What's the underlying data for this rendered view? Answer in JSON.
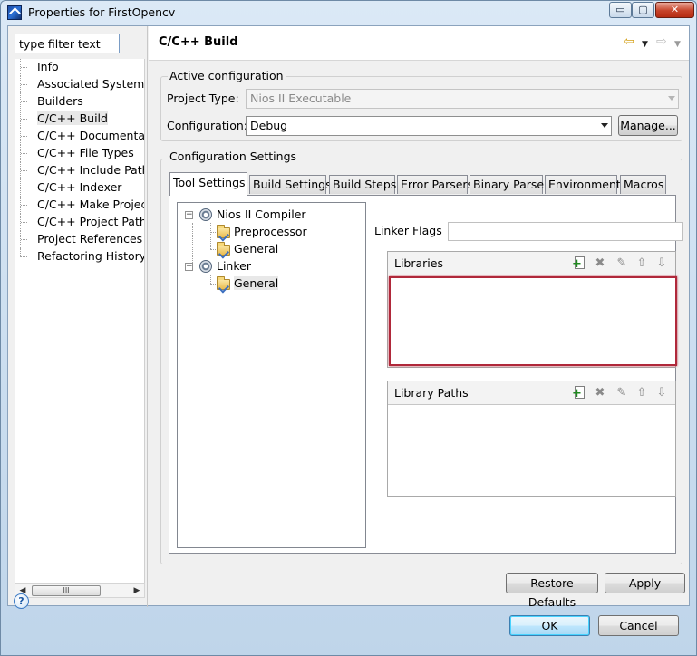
{
  "window": {
    "title": "Properties for FirstOpencv",
    "minimize_glyph": "▭",
    "maximize_glyph": "▢",
    "close_glyph": "✕"
  },
  "filter": {
    "value": "type filter text"
  },
  "nav": {
    "items": [
      {
        "label": "Info"
      },
      {
        "label": "Associated System Lib"
      },
      {
        "label": "Builders"
      },
      {
        "label": "C/C++ Build",
        "selected": true
      },
      {
        "label": "C/C++ Documentatio"
      },
      {
        "label": "C/C++ File Types"
      },
      {
        "label": "C/C++ Include Paths"
      },
      {
        "label": "C/C++ Indexer"
      },
      {
        "label": "C/C++ Make Project"
      },
      {
        "label": "C/C++ Project Paths"
      },
      {
        "label": "Project References"
      },
      {
        "label": "Refactoring History"
      }
    ],
    "scroll_thumb_glyph": "III"
  },
  "page": {
    "title": "C/C++ Build",
    "back_glyph": "⇦",
    "forward_glyph": "⇨",
    "dropdown_glyph": "▼"
  },
  "active_config": {
    "group_label": "Active configuration",
    "project_type_label": "Project Type:",
    "project_type_value": "Nios II Executable",
    "configuration_label": "Configuration:",
    "configuration_value": "Debug",
    "manage_label": "Manage..."
  },
  "config_settings": {
    "group_label": "Configuration Settings",
    "tabs": [
      {
        "label": "Tool Settings",
        "active": true
      },
      {
        "label": "Build Settings"
      },
      {
        "label": "Build Steps"
      },
      {
        "label": "Error Parsers"
      },
      {
        "label": "Binary Parser"
      },
      {
        "label": "Environment"
      },
      {
        "label": "Macros"
      }
    ]
  },
  "tool_tree": {
    "compiler": "Nios II Compiler",
    "compiler_children": [
      "Preprocessor",
      "General"
    ],
    "linker": "Linker",
    "linker_children": [
      "General"
    ],
    "expander_glyph": "−"
  },
  "linker": {
    "flags_label": "Linker Flags",
    "flags_value": "",
    "libraries_label": "Libraries",
    "library_paths_label": "Library Paths",
    "libraries": [],
    "library_paths": []
  },
  "list_tools": {
    "add_glyph": "+",
    "delete_glyph": "✖",
    "edit_glyph": "✎",
    "up_glyph": "⇧",
    "down_glyph": "⇩"
  },
  "buttons": {
    "restore_defaults": "Restore Defaults",
    "apply": "Apply",
    "ok": "OK",
    "cancel": "Cancel",
    "help_glyph": "?"
  },
  "scroll": {
    "left_glyph": "◀",
    "right_glyph": "▶"
  }
}
